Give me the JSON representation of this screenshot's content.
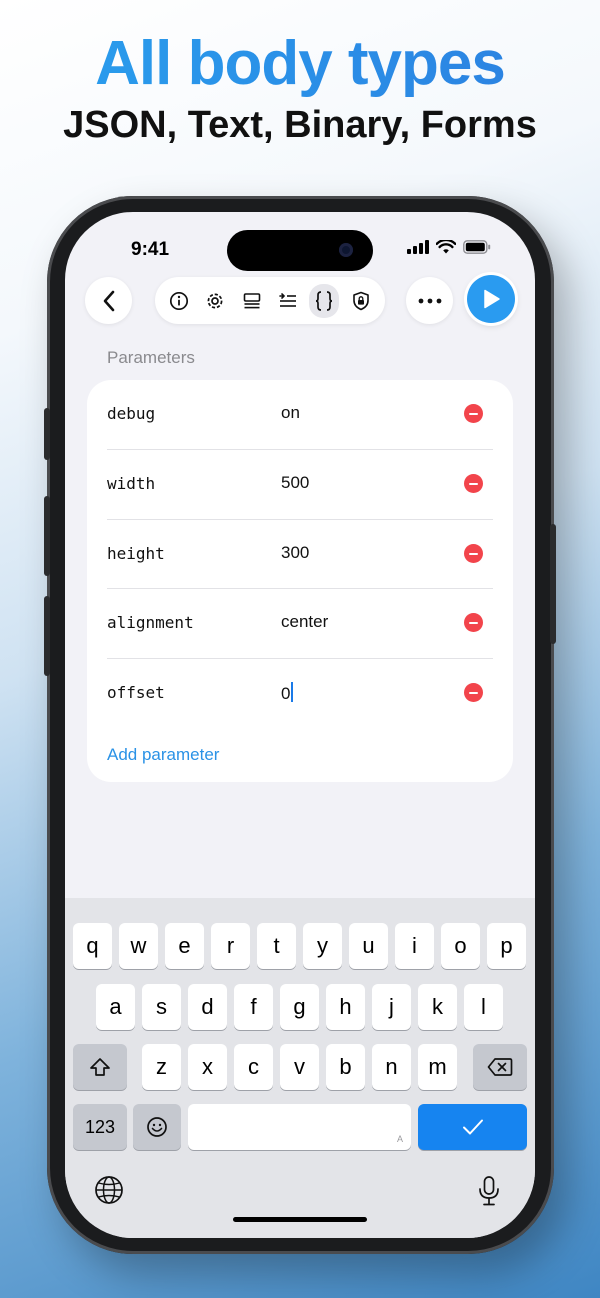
{
  "header": {
    "title": "All body types",
    "subtitle": "JSON, Text, Binary, Forms"
  },
  "status_bar": {
    "time": "9:41"
  },
  "toolbar": {
    "icons": [
      "info-icon",
      "gear-icon",
      "headers-icon",
      "params-icon",
      "braces-icon",
      "lock-icon"
    ],
    "active": "braces-icon"
  },
  "section": {
    "title": "Parameters"
  },
  "parameters": [
    {
      "key": "debug",
      "value": "on"
    },
    {
      "key": "width",
      "value": "500"
    },
    {
      "key": "height",
      "value": "300"
    },
    {
      "key": "alignment",
      "value": "center"
    },
    {
      "key": "offset",
      "value": "0"
    }
  ],
  "add_parameter_label": "Add parameter",
  "keyboard": {
    "row1": [
      "q",
      "w",
      "e",
      "r",
      "t",
      "y",
      "u",
      "i",
      "o",
      "p"
    ],
    "row2": [
      "a",
      "s",
      "d",
      "f",
      "g",
      "h",
      "j",
      "k",
      "l"
    ],
    "row3": [
      "z",
      "x",
      "c",
      "v",
      "b",
      "n",
      "m"
    ],
    "numbers_label": "123",
    "space_hint": "A"
  },
  "colors": {
    "accent": "#2a9bf0",
    "delete": "#f2444b",
    "link": "#2a92e6"
  }
}
